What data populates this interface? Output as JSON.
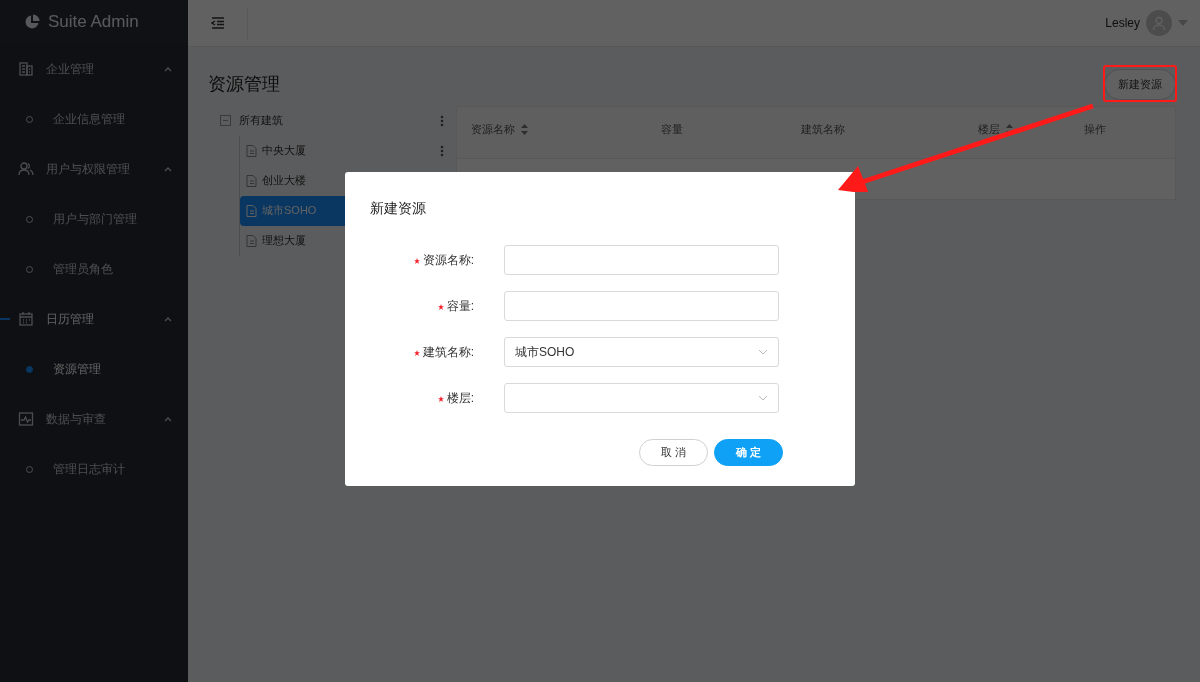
{
  "sidebar": {
    "logo": "Suite Admin",
    "groups": [
      {
        "label": "企业管理",
        "expanded": true,
        "selected": false,
        "children": [
          {
            "label": "企业信息管理",
            "selected": false
          }
        ]
      },
      {
        "label": "用户与权限管理",
        "expanded": true,
        "selected": false,
        "children": [
          {
            "label": "用户与部门管理",
            "selected": false
          },
          {
            "label": "管理员角色",
            "selected": false
          }
        ]
      },
      {
        "label": "日历管理",
        "expanded": true,
        "selected": true,
        "children": [
          {
            "label": "资源管理",
            "selected": true
          }
        ]
      },
      {
        "label": "数据与审查",
        "expanded": true,
        "selected": false,
        "children": [
          {
            "label": "管理日志审计",
            "selected": false
          }
        ]
      }
    ]
  },
  "header": {
    "user": "Lesley"
  },
  "page": {
    "title": "资源管理",
    "new_button": "新建资源"
  },
  "tree": {
    "label": "所有建筑",
    "expanded": true,
    "children": [
      {
        "label": "中央大厦",
        "selected": false,
        "more": true
      },
      {
        "label": "创业大楼",
        "selected": false
      },
      {
        "label": "城市SOHO",
        "selected": true
      },
      {
        "label": "理想大厦",
        "selected": false
      }
    ]
  },
  "table": {
    "columns": [
      {
        "label": "资源名称",
        "sortable": true
      },
      {
        "label": "容量",
        "sortable": false
      },
      {
        "label": "建筑名称",
        "sortable": false
      },
      {
        "label": "楼层",
        "sortable": true
      },
      {
        "label": "操作",
        "sortable": false
      }
    ]
  },
  "modal": {
    "title": "新建资源",
    "fields": [
      {
        "kind": "input",
        "label": "资源名称:",
        "required": true
      },
      {
        "kind": "input",
        "label": "容量:",
        "required": true
      },
      {
        "kind": "select",
        "label": "建筑名称:",
        "required": true,
        "value": "城市SOHO"
      },
      {
        "kind": "select",
        "label": "楼层:",
        "required": true
      }
    ],
    "buttons": [
      {
        "kind": "default",
        "label": "取 消"
      },
      {
        "kind": "primary",
        "label": "确 定"
      }
    ]
  }
}
